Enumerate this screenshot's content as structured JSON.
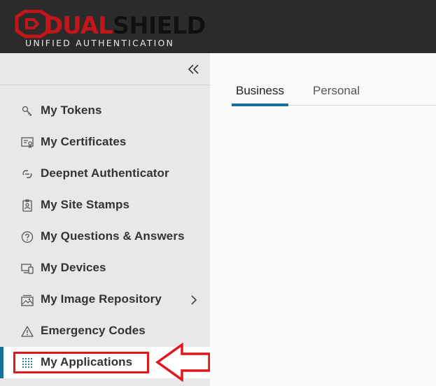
{
  "header": {
    "logo_main_part1": "DUAL",
    "logo_main_part2": "SHIELD",
    "logo_sub": "UNIFIED AUTHENTICATION",
    "brand_red": "#c2161b"
  },
  "sidebar": {
    "collapse_icon": "double-chevron-left-icon",
    "items": [
      {
        "label": "My Tokens",
        "icon": "key-icon"
      },
      {
        "label": "My Certificates",
        "icon": "certificate-icon"
      },
      {
        "label": "Deepnet Authenticator",
        "icon": "authenticator-icon"
      },
      {
        "label": "My Site Stamps",
        "icon": "badge-icon"
      },
      {
        "label": "My Questions & Answers",
        "icon": "question-circle-icon"
      },
      {
        "label": "My Devices",
        "icon": "devices-icon"
      },
      {
        "label": "My Image Repository",
        "icon": "image-repository-icon",
        "has_submenu": true
      },
      {
        "label": "Emergency Codes",
        "icon": "warning-icon"
      },
      {
        "label": "My Applications",
        "icon": "grid-dots-icon",
        "active": true
      }
    ]
  },
  "main": {
    "tabs": [
      {
        "label": "Business",
        "selected": true
      },
      {
        "label": "Personal",
        "selected": false
      }
    ]
  },
  "colors": {
    "accent": "#1a6e9a",
    "annotation_red": "#e3161c"
  }
}
